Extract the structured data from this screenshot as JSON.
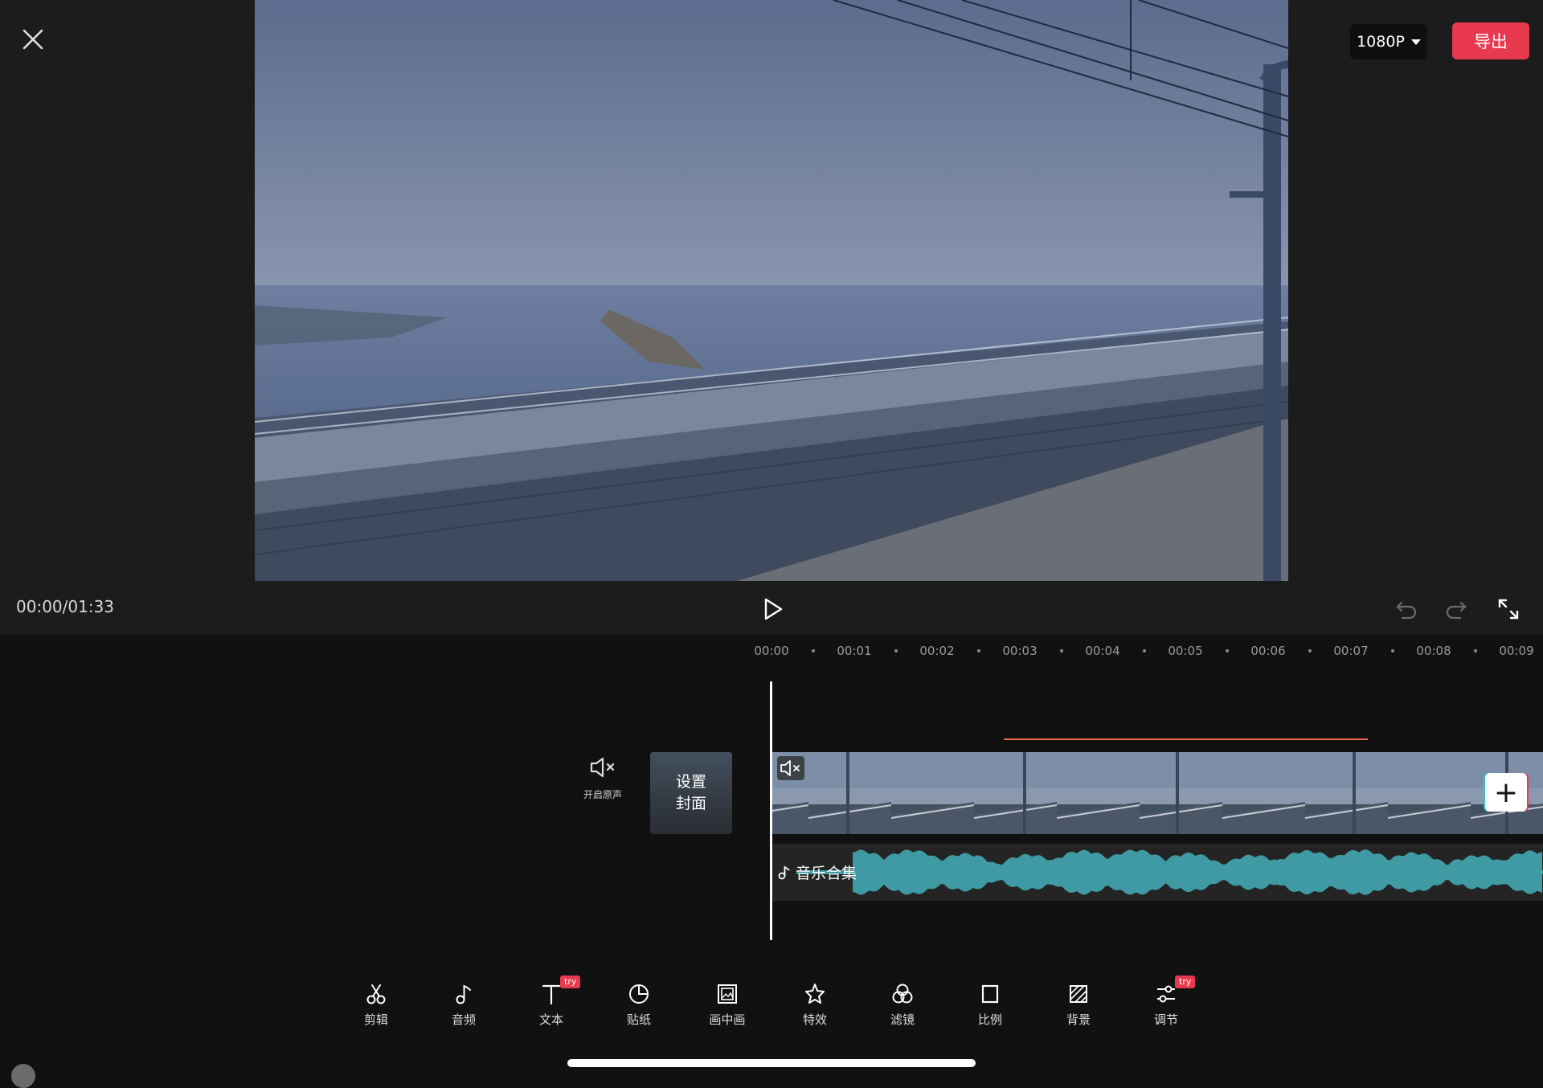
{
  "header": {
    "close_icon": "close-icon",
    "resolution_label": "1080P",
    "export_label": "导出",
    "export_color": "#e8394f"
  },
  "playback": {
    "time_display": "00:00/01:33",
    "play_icon": "play-icon",
    "undo_icon": "undo-icon",
    "redo_icon": "redo-icon",
    "fullscreen_icon": "fullscreen-icon"
  },
  "ruler": {
    "ticks": [
      "00:00",
      "00:01",
      "00:02",
      "00:03",
      "00:04",
      "00:05",
      "00:06",
      "00:07",
      "00:08",
      "00:09"
    ]
  },
  "track": {
    "mute_label": "开启原声",
    "cover_line1": "设置",
    "cover_line2": "封面",
    "audio_label": "音乐合集",
    "audio_color": "#3f9aa3"
  },
  "toolbar": {
    "items": [
      {
        "label": "剪辑",
        "icon": "scissors-icon",
        "try": ""
      },
      {
        "label": "音频",
        "icon": "music-note-icon",
        "try": ""
      },
      {
        "label": "文本",
        "icon": "text-icon",
        "try": "try"
      },
      {
        "label": "贴纸",
        "icon": "sticker-icon",
        "try": ""
      },
      {
        "label": "画中画",
        "icon": "picture-in-picture-icon",
        "try": ""
      },
      {
        "label": "特效",
        "icon": "effects-star-icon",
        "try": ""
      },
      {
        "label": "滤镜",
        "icon": "filter-icon",
        "try": ""
      },
      {
        "label": "比例",
        "icon": "ratio-icon",
        "try": ""
      },
      {
        "label": "背景",
        "icon": "background-icon",
        "try": ""
      },
      {
        "label": "调节",
        "icon": "adjust-icon",
        "try": "try"
      }
    ]
  }
}
